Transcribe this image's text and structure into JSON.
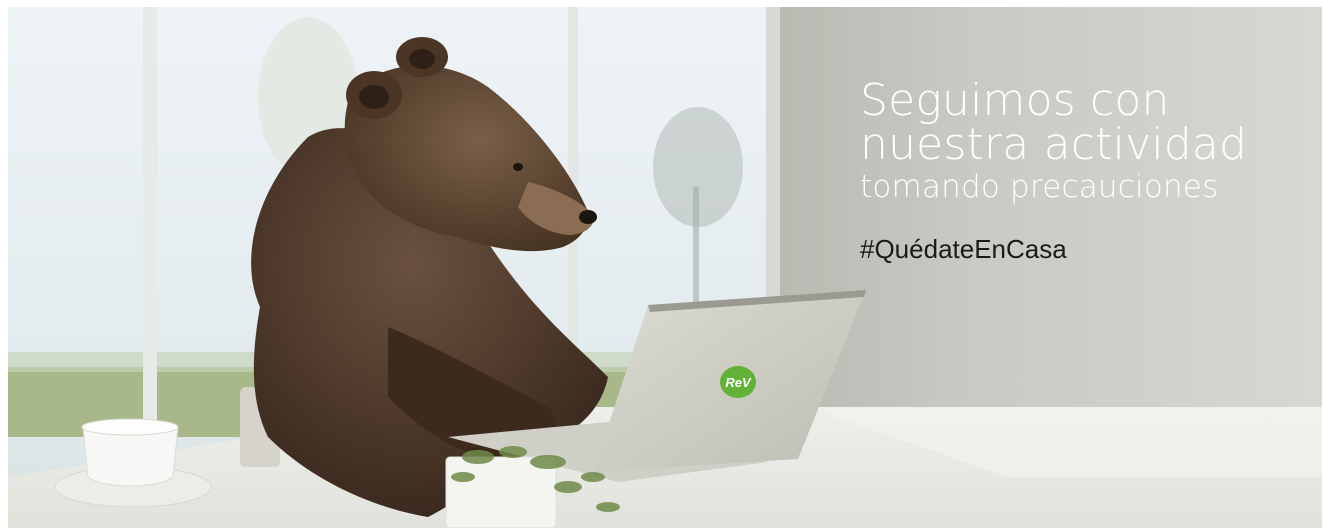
{
  "banner": {
    "headline_line1": "Seguimos con",
    "headline_line2": "nuestra actividad",
    "headline_line3": "tomando precauciones",
    "hashtag": "#QuédateEnCasa",
    "logo_text": "ReV"
  }
}
